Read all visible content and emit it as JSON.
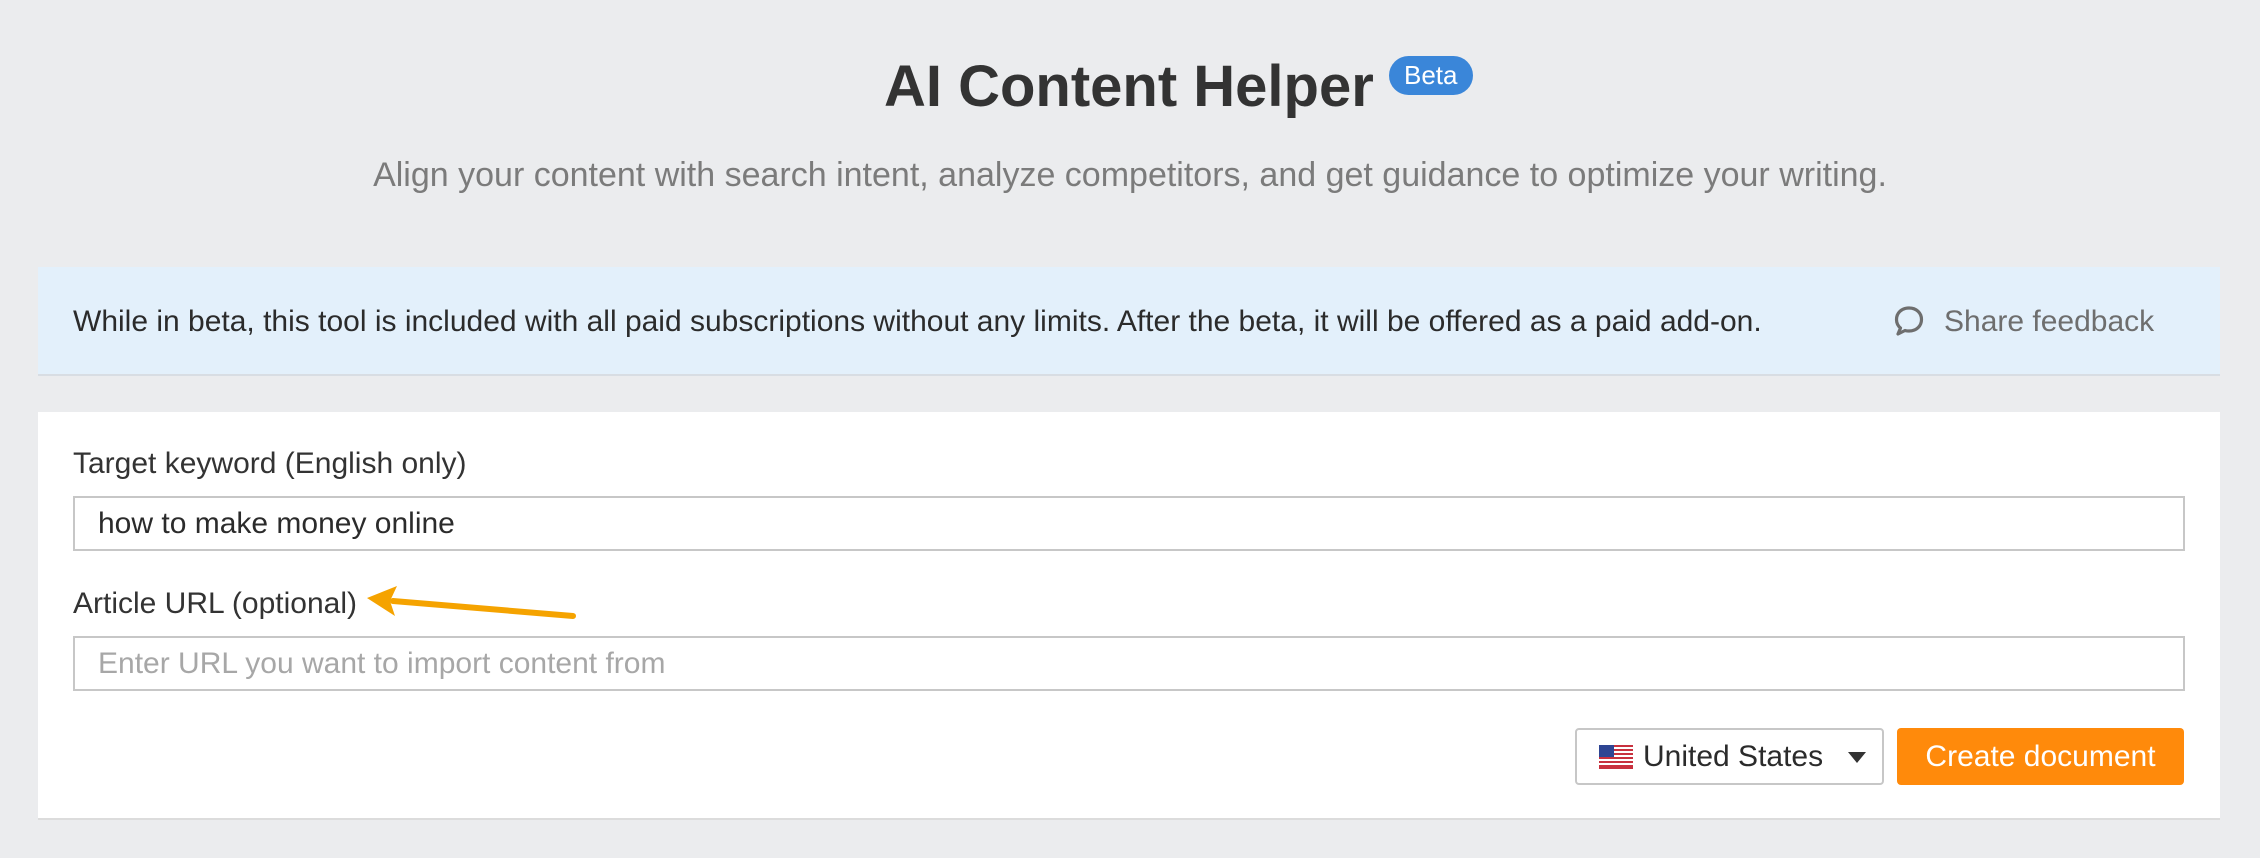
{
  "header": {
    "title": "AI Content Helper",
    "badge": "Beta",
    "subtitle": "Align your content with search intent, analyze competitors, and get guidance to optimize your writing."
  },
  "notice": {
    "text": "While in beta, this tool is included with all paid subscriptions without any limits. After the beta, it will be offered as a paid add-on.",
    "feedback_label": "Share feedback",
    "feedback_icon": "speech-bubble-icon"
  },
  "form": {
    "keyword_label": "Target keyword (English only)",
    "keyword_value": "how to make money online",
    "url_label": "Article URL (optional)",
    "url_value": "",
    "url_placeholder": "Enter URL you want to import content from",
    "country": {
      "selected": "United States",
      "flag_icon": "us-flag-icon"
    },
    "create_label": "Create document"
  },
  "colors": {
    "background": "#ebecee",
    "badge": "#3a86d9",
    "notice_bg": "#e3f0fb",
    "primary_button": "#ff8a0b",
    "annotation_arrow": "#f5a300"
  }
}
